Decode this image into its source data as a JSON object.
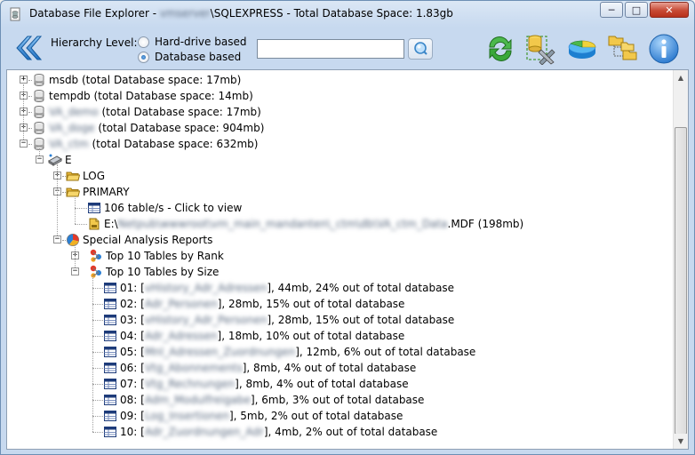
{
  "window": {
    "title_prefix": "Database File Explorer - ",
    "title_host_blurred": "vmserver",
    "title_suffix": "\\SQLEXPRESS - Total Database Space: 1.83gb",
    "min_glyph": "─",
    "max_glyph": "□",
    "close_glyph": "✕"
  },
  "toolbar": {
    "hierarchy_label": "Hierarchy Level:",
    "radio_hard_drive": "Hard-drive based",
    "radio_database": "Database based",
    "selected_radio": "Database based",
    "search_value": "",
    "icons": [
      "back-arrow-icon",
      "search-icon",
      "refresh-icon",
      "database-tools-icon",
      "pie-chart-icon",
      "folder-tree-icon",
      "info-icon"
    ]
  },
  "tree": {
    "databases": [
      {
        "name": "msdb",
        "suffix": " (total Database space: 17mb)",
        "blurred": false
      },
      {
        "name": "tempdb",
        "suffix": " (total Database space: 14mb)",
        "blurred": false
      },
      {
        "name": "VA_demo",
        "suffix": " (total Database space: 17mb)",
        "blurred": true
      },
      {
        "name": "VA_doge",
        "suffix": " (total Database space: 904mb)",
        "blurred": true
      },
      {
        "name": "VA_ctm",
        "suffix": " (total Database space: 632mb)",
        "blurred": true
      }
    ],
    "drive": "E",
    "log_folder": "LOG",
    "primary_folder": "PRIMARY",
    "tables_link": "106 table/s - Click to view",
    "mdf_prefix": "E:\\",
    "mdf_blurred": "Netpub\\wwwroot\\vm_main_mandanten\\_ctm\\db\\VA_ctm_Data",
    "mdf_suffix": ".MDF (198mb)",
    "reports": "Special Analysis Reports",
    "top_rank": "Top 10 Tables by Rank",
    "top_size": "Top 10 Tables by Size",
    "size_items": [
      {
        "prefix": "01: [",
        "name": "vHistory_Adr_Adressen",
        "suffix": "], 44mb, 24% out of total database"
      },
      {
        "prefix": "02: [",
        "name": "Adr_Personen",
        "suffix": "], 28mb, 15% out of total database"
      },
      {
        "prefix": "03: [",
        "name": "vHistory_Adr_Personen",
        "suffix": "], 28mb, 15% out of total database"
      },
      {
        "prefix": "04: [",
        "name": "Adr_Adressen",
        "suffix": "], 18mb, 10% out of total database"
      },
      {
        "prefix": "05: [",
        "name": "Mnl_Adressen_Zuordnungen",
        "suffix": "], 12mb, 6% out of total database"
      },
      {
        "prefix": "06: [",
        "name": "Vtg_Abonnements",
        "suffix": "], 8mb, 4% out of total database"
      },
      {
        "prefix": "07: [",
        "name": "Vtg_Rechnungen",
        "suffix": "], 8mb, 4% out of total database"
      },
      {
        "prefix": "08: [",
        "name": "Adm_Modulfreigabe",
        "suffix": "], 6mb, 3% out of total database"
      },
      {
        "prefix": "09: [",
        "name": "Log_Insertionen",
        "suffix": "], 5mb, 2% out of total database"
      },
      {
        "prefix": "10: [",
        "name": "Adr_Zuordnungen_Adr",
        "suffix": "], 4mb, 2% out of total database"
      }
    ]
  },
  "colors": {
    "accent_blue": "#2a7fd4",
    "folder_yellow": "#f2c84b",
    "refresh_green": "#3aa83a"
  }
}
